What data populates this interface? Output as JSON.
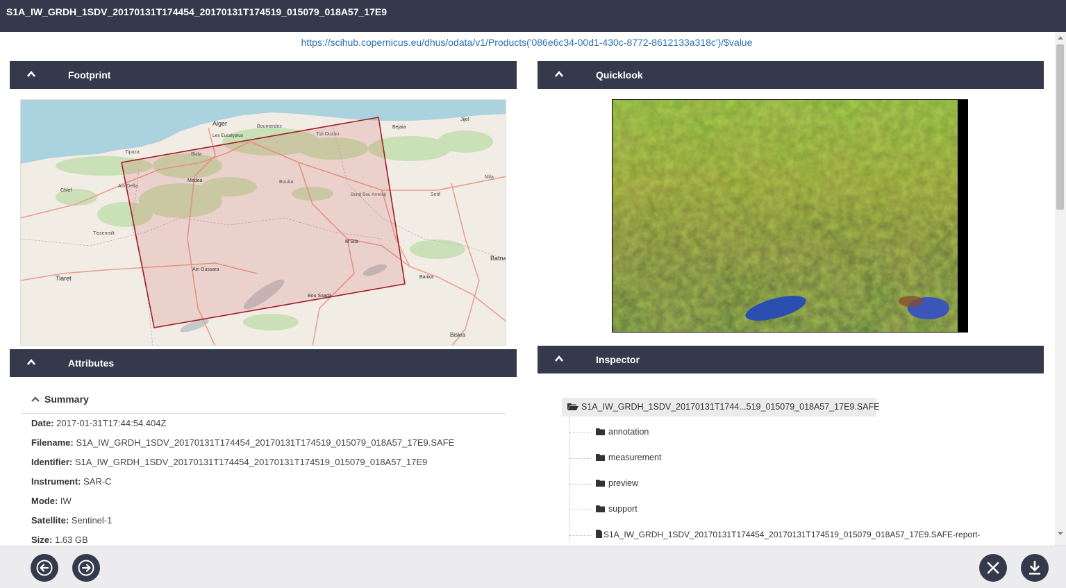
{
  "window": {
    "title": "S1A_IW_GRDH_1SDV_20170131T174454_20170131T174519_015079_018A57_17E9"
  },
  "download_url": "https://scihub.copernicus.eu/dhus/odata/v1/Products('086e6c34-00d1-430c-8772-8612133a318c')/$value",
  "panels": {
    "footprint": "Footprint",
    "quicklook": "Quicklook",
    "attributes": "Attributes",
    "inspector": "Inspector"
  },
  "map": {
    "labels": [
      "Alger",
      "Les Eucalyptus",
      "Boumerdes",
      "Tizi Ouzou",
      "Bejaia",
      "Jijel",
      "Tipaza",
      "Blida",
      "Medea",
      "Bouira",
      "Chlef",
      "Ain Defla",
      "Bordj Bou Arreridj",
      "Setif",
      "Mila",
      "Tissemsilt",
      "M'Sila",
      "Batna",
      "Tiaret",
      "Ain Oussara",
      "Barika",
      "Bou Saada",
      "Biskra"
    ]
  },
  "summary": {
    "heading": "Summary",
    "rows": [
      {
        "label": "Date:",
        "value": "2017-01-31T17:44:54.404Z"
      },
      {
        "label": "Filename:",
        "value": "S1A_IW_GRDH_1SDV_20170131T174454_20170131T174519_015079_018A57_17E9.SAFE"
      },
      {
        "label": "Identifier:",
        "value": "S1A_IW_GRDH_1SDV_20170131T174454_20170131T174519_015079_018A57_17E9"
      },
      {
        "label": "Instrument:",
        "value": "SAR-C"
      },
      {
        "label": "Mode:",
        "value": "IW"
      },
      {
        "label": "Satellite:",
        "value": "Sentinel-1"
      },
      {
        "label": "Size:",
        "value": "1.63 GB"
      }
    ]
  },
  "inspector": {
    "root": "S1A_IW_GRDH_1SDV_20170131T1744...519_015079_018A57_17E9.SAFE",
    "items": [
      {
        "type": "folder",
        "label": "annotation"
      },
      {
        "type": "folder",
        "label": "measurement"
      },
      {
        "type": "folder",
        "label": "preview"
      },
      {
        "type": "folder",
        "label": "support"
      },
      {
        "type": "file",
        "label": "S1A_IW_GRDH_1SDV_20170131T174454_20170131T174519_015079_018A57_17E9.SAFE-report-"
      }
    ]
  },
  "footer": {
    "prev_icon": "arrow-left-icon",
    "next_icon": "arrow-right-icon",
    "close_icon": "close-icon",
    "download_icon": "download-icon"
  },
  "colors": {
    "header_bg": "#343a4c",
    "link": "#2a6fb5",
    "footprint_stroke": "#a01d24",
    "footprint_fill": "rgba(200,60,60,0.15)"
  }
}
